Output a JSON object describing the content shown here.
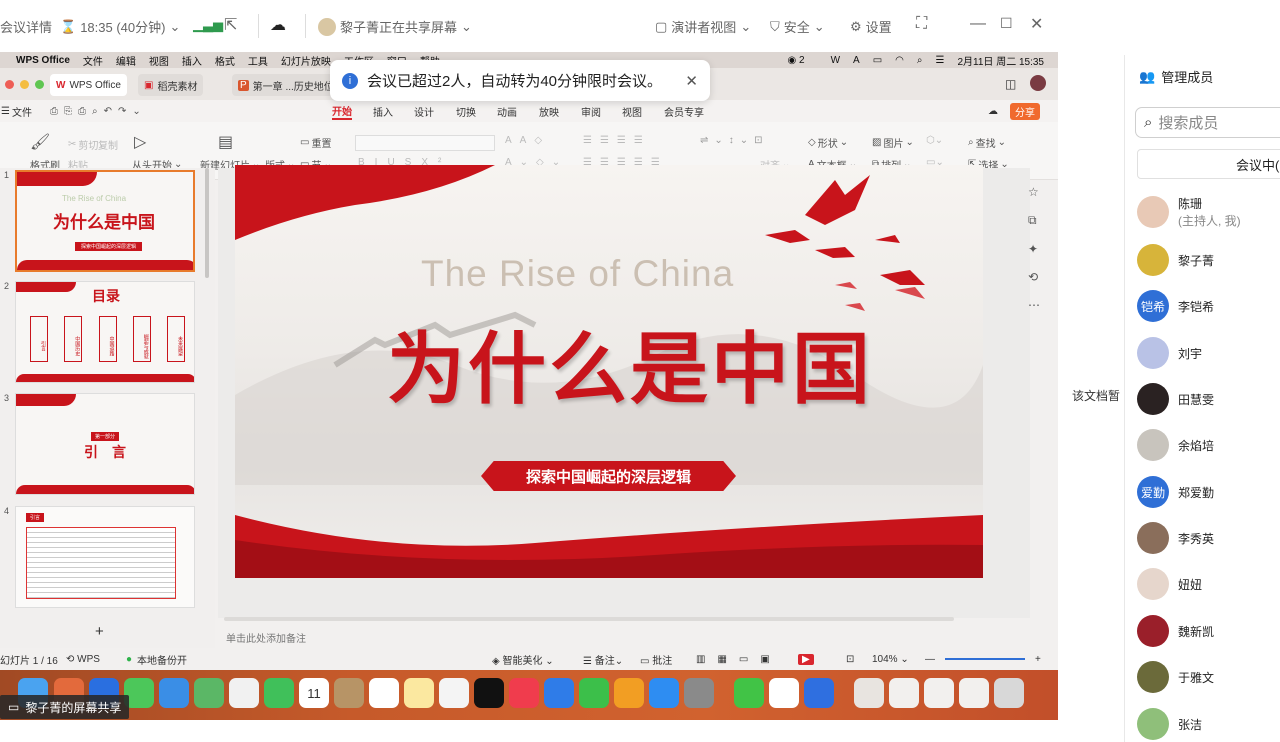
{
  "meeting_bar": {
    "details": "会议详情",
    "timer": "18:35 (40分钟)",
    "sharing": "黎子菁正在共享屏幕",
    "presenter_view": "演讲者视图",
    "security": "安全",
    "settings": "设置"
  },
  "mac_menu": {
    "items": [
      "WPS Office",
      "文件",
      "编辑",
      "视图",
      "插入",
      "格式",
      "工具",
      "幻灯片放映",
      "工作区",
      "窗口",
      "帮助"
    ],
    "wechat_count": "2",
    "datetime": "2月11日 周二 15:35"
  },
  "wps_tabs": [
    "WPS Office",
    "稻壳素材",
    "第一章 ...历史地位"
  ],
  "notice": {
    "text": "会议已超过2人，自动转为40分钟限时会议。"
  },
  "menubar": {
    "file": "文件",
    "tabs": [
      "开始",
      "插入",
      "设计",
      "切换",
      "动画",
      "放映",
      "审阅",
      "视图",
      "会员专享"
    ],
    "share": "分享"
  },
  "ribbon": {
    "format_brush": "格式刷",
    "cut": "剪切",
    "copy": "复制",
    "paste": "粘贴",
    "from_start": "从头开始",
    "new_slide": "新建幻灯片",
    "layout": "版式",
    "reset": "重置",
    "section": "节",
    "shape": "形状",
    "picture": "图片",
    "find": "查找",
    "textbox": "文本框",
    "arrange": "排列",
    "select": "选择",
    "align": "对齐"
  },
  "thumbnails": [
    {
      "num": "1",
      "title_en": "The Rise of China",
      "title": "为什么是中国",
      "sub": "探索中国崛起的深层逻辑"
    },
    {
      "num": "2",
      "title": "目录",
      "items": [
        "引言",
        "中国历史",
        "中国道路",
        "崛起与成就",
        "未来展望"
      ]
    },
    {
      "num": "3",
      "tag": "第一部分",
      "title": "引　言"
    },
    {
      "num": "4",
      "title": "引言"
    }
  ],
  "slide": {
    "title_en": "The Rise of China",
    "title": "为什么是中国",
    "subtitle": "探索中国崛起的深层逻辑"
  },
  "notes_placeholder": "单击此处添加备注",
  "statusbar": {
    "slide_count": "幻灯片 1 / 16",
    "wps": "WPS",
    "backup": "本地备份开",
    "beautify": "智能美化",
    "notes": "备注",
    "comments": "批注",
    "zoom": "104%"
  },
  "share_label": "黎子菁的屏幕共享",
  "side_text": "该文档暂",
  "members": {
    "header": "管理成员",
    "search_placeholder": "搜索成员",
    "in_meeting": "会议中(",
    "list": [
      {
        "name": "陈珊",
        "role": "(主持人, 我)",
        "avatar": "photo",
        "color": "#e8c9b6"
      },
      {
        "name": "黎子菁",
        "avatar": "photo",
        "color": "#d7b43a"
      },
      {
        "name": "李铠希",
        "avatar": "铠希",
        "color": "#2f6fd6"
      },
      {
        "name": "刘宇",
        "avatar": "",
        "color": "#b9c2e6"
      },
      {
        "name": "田慧雯",
        "avatar": "photo",
        "color": "#2a2222"
      },
      {
        "name": "余焰培",
        "avatar": "photo",
        "color": "#c8c4bd"
      },
      {
        "name": "郑爱勤",
        "avatar": "爱勤",
        "color": "#2f6fd6"
      },
      {
        "name": "李秀英",
        "avatar": "photo",
        "color": "#8a6e5b"
      },
      {
        "name": "妞妞",
        "avatar": "photo",
        "color": "#e6d6cc"
      },
      {
        "name": "魏新凯",
        "avatar": "photo",
        "color": "#9a1f2a"
      },
      {
        "name": "于雅文",
        "avatar": "photo",
        "color": "#6b6a3a"
      },
      {
        "name": "张洁",
        "avatar": "photo",
        "color": "#8fbf7a"
      }
    ]
  }
}
